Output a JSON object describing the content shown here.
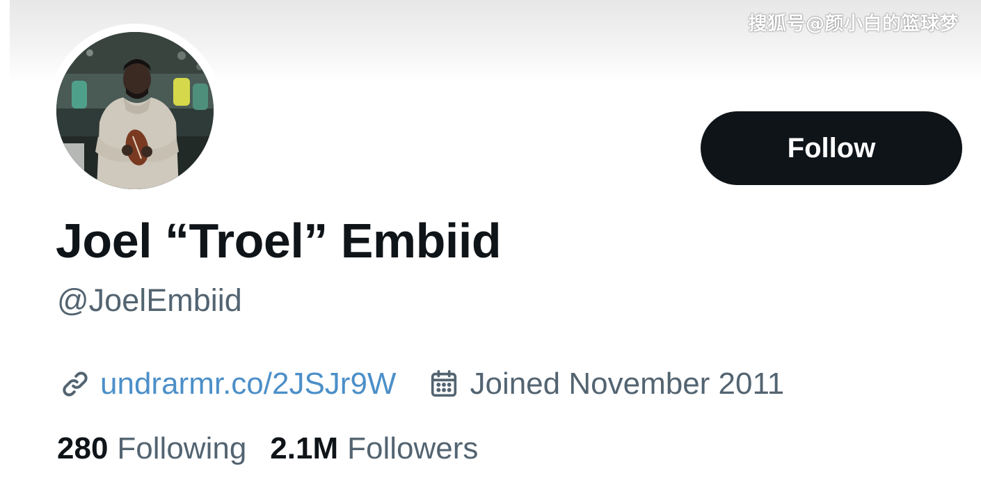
{
  "watermark": {
    "text": "搜狐号@颜小白的篮球梦"
  },
  "profile": {
    "display_name": "Joel “Troel” Embiid",
    "handle": "@JoelEmbiid",
    "avatar_alt": "avatar-photo"
  },
  "actions": {
    "follow_label": "Follow"
  },
  "meta": {
    "website_text": "undrarmr.co/2JSJr9W",
    "website_icon": "link-icon",
    "joined_text": "Joined November 2011",
    "joined_icon": "calendar-icon"
  },
  "stats": {
    "following_count": "280",
    "following_label": "Following",
    "followers_count": "2.1M",
    "followers_label": "Followers"
  },
  "colors": {
    "text_primary": "#0f1419",
    "text_secondary": "#536471",
    "link": "#4c8fc8",
    "button_bg": "#0f1419",
    "button_text": "#ffffff"
  }
}
